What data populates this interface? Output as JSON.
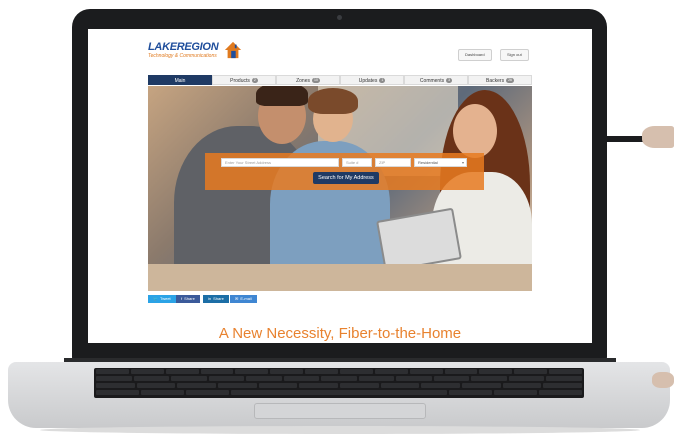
{
  "site": {
    "logo": {
      "name": "LAKEREGION",
      "subtitle": "Technology & Communications"
    },
    "header_buttons": [
      "Dashboard",
      "Sign out"
    ],
    "nav": [
      {
        "label": "Main",
        "active": true
      },
      {
        "label": "Products",
        "badge": "2"
      },
      {
        "label": "Zones",
        "badge": "10"
      },
      {
        "label": "Updates",
        "badge": "1"
      },
      {
        "label": "Comments",
        "badge": "3"
      },
      {
        "label": "Backers",
        "badge": "26"
      }
    ],
    "search": {
      "street_placeholder": "Enter Your Street Address",
      "suite_placeholder": "Suite #",
      "zip_placeholder": "ZIP",
      "type_select": "Residential",
      "button": "Search for My Address"
    },
    "share": [
      {
        "label": "Tweet",
        "color": "#2ba3e6",
        "icon": "twitter-icon",
        "glyph": "🐦"
      },
      {
        "label": "Share",
        "color": "#3b5a9a",
        "icon": "facebook-icon",
        "glyph": "f"
      },
      {
        "label": "Share",
        "color": "#1c6ea6",
        "icon": "linkedin-icon",
        "glyph": "in"
      },
      {
        "label": "E-mail",
        "color": "#3f86d2",
        "icon": "email-icon",
        "glyph": "✉"
      }
    ],
    "tagline": "A New Necessity, Fiber-to-the-Home"
  },
  "colors": {
    "accent": "#e8822f",
    "nav_active": "#1f3a64",
    "brand_blue": "#1f4e9c"
  }
}
